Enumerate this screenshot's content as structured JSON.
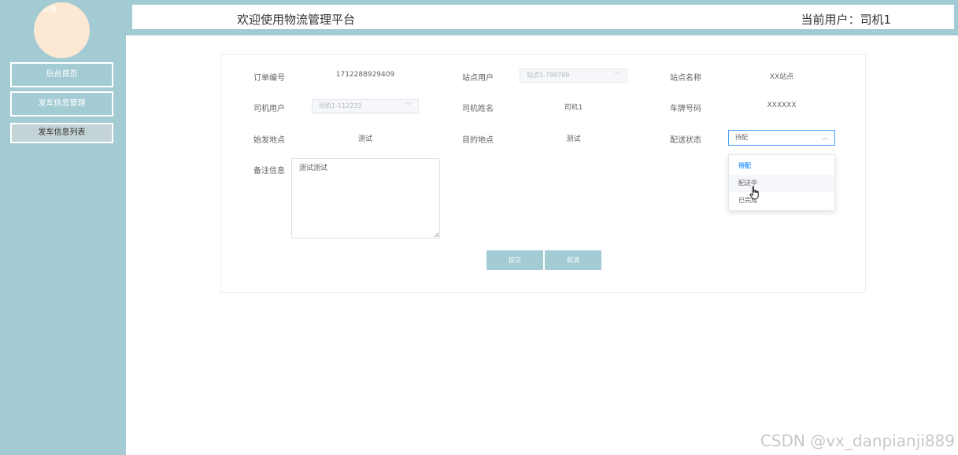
{
  "sidebar": {
    "avatar_alt": "头像",
    "nav": [
      {
        "label": "后台首页"
      },
      {
        "label": "发车信息管理"
      },
      {
        "label": "发车信息列表"
      }
    ]
  },
  "header": {
    "title": "欢迎使用物流管理平台",
    "current_user": "当前用户：司机1"
  },
  "form": {
    "order_no_label": "订单编号",
    "order_no_value": "1712288929409",
    "station_user_label": "站点用户",
    "station_user_value": "站点1-789789",
    "station_name_label": "站点名称",
    "station_name_value": "XX站点",
    "driver_user_label": "司机用户",
    "driver_user_value": "司机1-112233",
    "driver_name_label": "司机姓名",
    "driver_name_value": "司机1",
    "plate_label": "车牌号码",
    "plate_value": "XXXXXX",
    "origin_label": "始发地点",
    "origin_value": "测试",
    "destination_label": "目的地点",
    "destination_value": "测试",
    "status_label": "配送状态",
    "status_value": "待配",
    "remark_label": "备注信息",
    "remark_value": "测试测试",
    "submit_label": "提交",
    "cancel_label": "取消"
  },
  "status_dropdown": {
    "options": [
      "待配",
      "配送中",
      "已完成"
    ],
    "selected": "待配",
    "hovered": "配送中"
  },
  "watermark": "CSDN @vx_danpianji889",
  "colors": {
    "theme": "#a3cbd4",
    "accent": "#409eff"
  }
}
